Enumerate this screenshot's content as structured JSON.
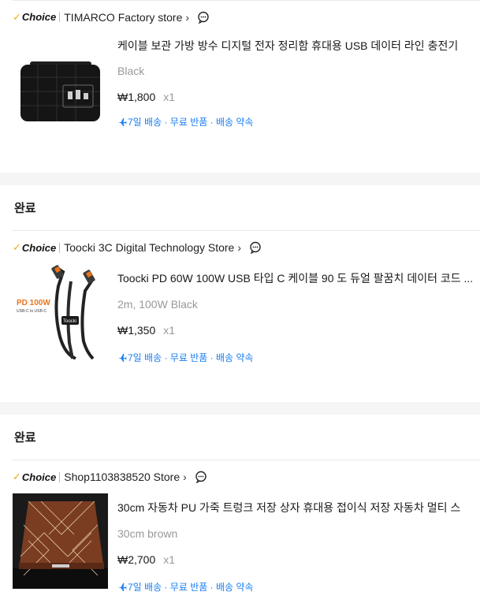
{
  "colors": {
    "accent_blue": "#1a7ef2",
    "choice_check": "#f5a623",
    "muted": "#999999",
    "divider": "#f5f5f5"
  },
  "orders": [
    {
      "status": "",
      "choice_badge": "Choice",
      "store_name": "TIMARCO Factory store",
      "product_title": "케이블 보관 가방 방수 디지털 전자 정리함 휴대용 USB 데이터 라인 충전기",
      "variant": "Black",
      "price": "₩1,800",
      "quantity": "x1",
      "delivery": "7일 배송 · 무료 반품 · 배송 약속",
      "thumbnail_icon": "black-cable-organizer-bag-image"
    },
    {
      "status": "완료",
      "choice_badge": "Choice",
      "store_name": "Toocki 3C Digital Technology Store",
      "product_title": "Toocki PD 60W 100W USB 타입 C 케이블 90 도 듀얼 팔꿈치 데이터 코드 ...",
      "variant": "2m, 100W Black",
      "price": "₩1,350",
      "quantity": "x1",
      "delivery": "7일 배송 · 무료 반품 · 배송 약속",
      "thumbnail_text": {
        "title": "PD 100W",
        "sub": "USB-C to USB-C",
        "brand": "Toocki"
      },
      "thumbnail_icon": "usb-c-cable-image"
    },
    {
      "status": "완료",
      "choice_badge": "Choice",
      "store_name": "Shop1103838520 Store",
      "product_title": "30cm 자동차 PU 가죽 트렁크 저장 상자 휴대용 접이식 저장 자동차 멀티 스",
      "variant": "30cm brown",
      "price": "₩2,700",
      "quantity": "x1",
      "delivery": "7일 배송 · 무료 반품 · 배송 약속",
      "thumbnail_icon": "leather-trunk-box-image"
    }
  ]
}
